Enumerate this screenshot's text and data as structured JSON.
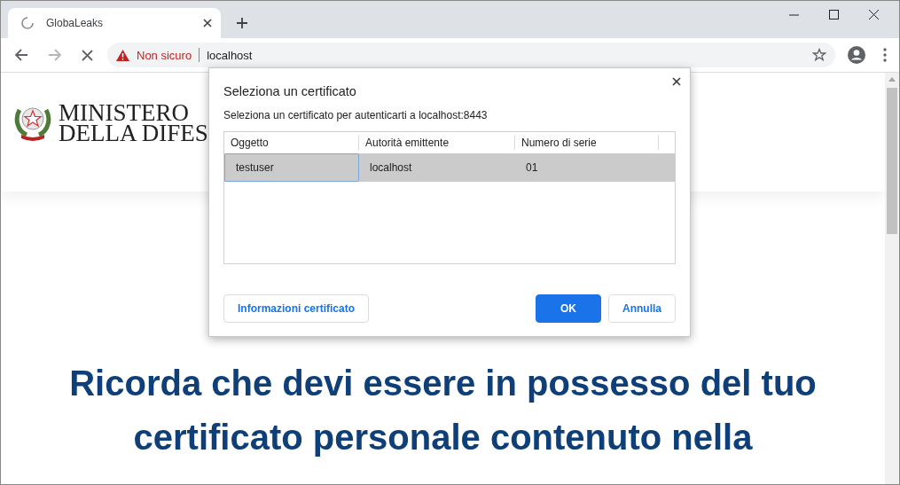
{
  "browser": {
    "tab": {
      "title": "GlobaLeaks",
      "loading": true
    },
    "address": {
      "security": "Non sicuro",
      "url": "localhost"
    }
  },
  "page": {
    "logo_lines": [
      "MINISTERO",
      "DELLA DIFES"
    ],
    "notice": "Ricorda che devi essere in possesso del tuo certificato personale contenuto nella"
  },
  "dialog": {
    "title": "Seleziona un certificato",
    "message": "Seleziona un certificato per autenticarti a localhost:8443",
    "columns": [
      "Oggetto",
      "Autorità emittente",
      "Numero di serie"
    ],
    "rows": [
      {
        "cells": [
          "testuser",
          "localhost",
          "01"
        ],
        "selected": true
      }
    ],
    "buttons": [
      {
        "label": "Informazioni certificato",
        "kind": "secondary"
      },
      {
        "label": "OK",
        "kind": "primary"
      },
      {
        "label": "Annulla",
        "kind": "secondary"
      }
    ]
  }
}
